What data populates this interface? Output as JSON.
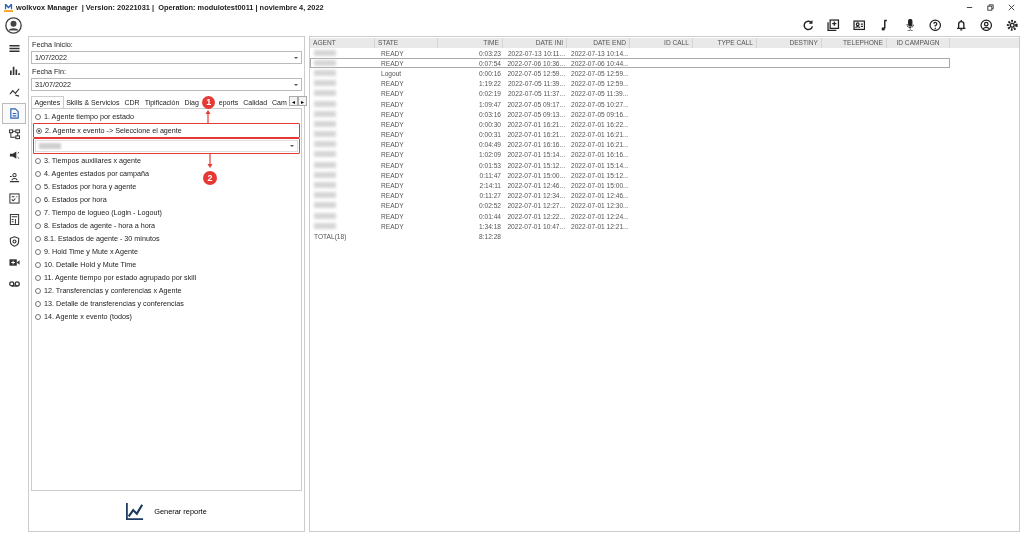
{
  "window": {
    "title": "wolkvox Manager  | Version: 20221031 |  Operation: modulotest0011 | noviembre 4, 2022"
  },
  "filters": {
    "start_label": "Fecha Inicio:",
    "start_value": "1/07/2022",
    "end_label": "Fecha Fin:",
    "end_value": "31/07/2022"
  },
  "tabs": [
    {
      "label": "Agentes",
      "selected": true
    },
    {
      "label": "Skills & Servicios",
      "selected": false
    },
    {
      "label": "CDR",
      "selected": false
    },
    {
      "label": "Tipificación",
      "selected": false
    },
    {
      "label": "Diag",
      "selected": false
    },
    {
      "label": "eports",
      "selected": false
    },
    {
      "label": "Calidad",
      "selected": false
    },
    {
      "label": "Cam",
      "selected": false
    }
  ],
  "tab_scroll": [
    "◂",
    "▸"
  ],
  "reports": [
    {
      "label": "1. Agente tiempo por estado",
      "selected": false
    },
    {
      "label": "2. Agente x evento -> Seleccione el agente",
      "selected": true
    },
    {
      "label": "3. Tiempos auxiliares x agente",
      "selected": false
    },
    {
      "label": "4. Agentes estados por campaña",
      "selected": false
    },
    {
      "label": "5. Estados por hora y agente",
      "selected": false
    },
    {
      "label": "6. Estados por hora",
      "selected": false
    },
    {
      "label": "7. Tiempo de logueo (Login - Logout)",
      "selected": false
    },
    {
      "label": "8. Estados de agente - hora a hora",
      "selected": false
    },
    {
      "label": "8.1. Estados de agente - 30 minutos",
      "selected": false
    },
    {
      "label": "9. Hold Time y Mute x Agente",
      "selected": false
    },
    {
      "label": "10. Detalle Hold y Mute Time",
      "selected": false
    },
    {
      "label": "11. Agente tiempo por estado agrupado por skill",
      "selected": false
    },
    {
      "label": "12. Transferencias y conferencias x Agente",
      "selected": false
    },
    {
      "label": "13. Detalle de transferencias y conferencias",
      "selected": false
    },
    {
      "label": "14. Agente x evento (todos)",
      "selected": false
    }
  ],
  "generate_button": "Generar reporte",
  "annotations": [
    {
      "label": "1"
    },
    {
      "label": "2"
    }
  ],
  "table": {
    "columns": [
      "AGENT",
      "STATE",
      "TIME",
      "DATE INI",
      "DATE END",
      "ID CALL",
      "TYPE CALL",
      "DESTINY",
      "TELEPHONE",
      "ID CAMPAIGN"
    ],
    "rows": [
      {
        "state": "READY",
        "time": "0:03:23",
        "date_ini": "2022-07-13 10:11...",
        "date_end": "2022-07-13 10:14...",
        "selected": false
      },
      {
        "state": "READY",
        "time": "0:07:54",
        "date_ini": "2022-07-06 10:36...",
        "date_end": "2022-07-06 10:44...",
        "selected": true
      },
      {
        "state": "Logout",
        "time": "0:00:16",
        "date_ini": "2022-07-05 12:59...",
        "date_end": "2022-07-05 12:59...",
        "selected": false
      },
      {
        "state": "READY",
        "time": "1:19:22",
        "date_ini": "2022-07-05 11:39...",
        "date_end": "2022-07-05 12:59...",
        "selected": false
      },
      {
        "state": "READY",
        "time": "0:02:19",
        "date_ini": "2022-07-05 11:37...",
        "date_end": "2022-07-05 11:39...",
        "selected": false
      },
      {
        "state": "READY",
        "time": "1:09:47",
        "date_ini": "2022-07-05 09:17...",
        "date_end": "2022-07-05 10:27...",
        "selected": false
      },
      {
        "state": "READY",
        "time": "0:03:16",
        "date_ini": "2022-07-05 09:13...",
        "date_end": "2022-07-05 09:16...",
        "selected": false
      },
      {
        "state": "READY",
        "time": "0:00:30",
        "date_ini": "2022-07-01 16:21...",
        "date_end": "2022-07-01 16:22...",
        "selected": false
      },
      {
        "state": "READY",
        "time": "0:00:31",
        "date_ini": "2022-07-01 16:21...",
        "date_end": "2022-07-01 16:21...",
        "selected": false
      },
      {
        "state": "READY",
        "time": "0:04:49",
        "date_ini": "2022-07-01 16:16...",
        "date_end": "2022-07-01 16:21...",
        "selected": false
      },
      {
        "state": "READY",
        "time": "1:02:09",
        "date_ini": "2022-07-01 15:14...",
        "date_end": "2022-07-01 16:16...",
        "selected": false
      },
      {
        "state": "READY",
        "time": "0:01:53",
        "date_ini": "2022-07-01 15:12...",
        "date_end": "2022-07-01 15:14...",
        "selected": false
      },
      {
        "state": "READY",
        "time": "0:11:47",
        "date_ini": "2022-07-01 15:00...",
        "date_end": "2022-07-01 15:12...",
        "selected": false
      },
      {
        "state": "READY",
        "time": "2:14:11",
        "date_ini": "2022-07-01 12:46...",
        "date_end": "2022-07-01 15:00...",
        "selected": false
      },
      {
        "state": "READY",
        "time": "0:11:27",
        "date_ini": "2022-07-01 12:34...",
        "date_end": "2022-07-01 12:46...",
        "selected": false
      },
      {
        "state": "READY",
        "time": "0:02:52",
        "date_ini": "2022-07-01 12:27...",
        "date_end": "2022-07-01 12:30...",
        "selected": false
      },
      {
        "state": "READY",
        "time": "0:01:44",
        "date_ini": "2022-07-01 12:22...",
        "date_end": "2022-07-01 12:24...",
        "selected": false
      },
      {
        "state": "READY",
        "time": "1:34:18",
        "date_ini": "2022-07-01 10:47...",
        "date_end": "2022-07-01 12:21...",
        "selected": false
      }
    ],
    "total": {
      "label": "TOTAL(18)",
      "time": "8:12:28"
    }
  }
}
